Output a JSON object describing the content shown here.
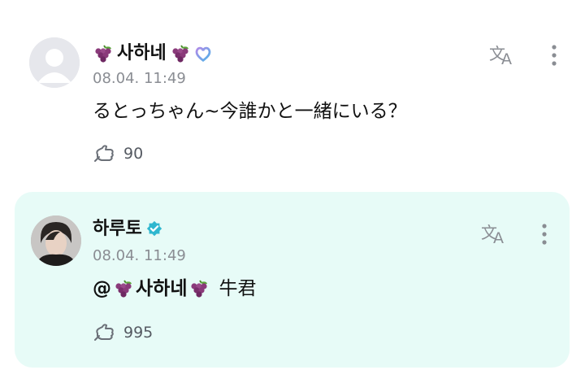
{
  "comments": [
    {
      "author": "사하네",
      "timestamp": "08.04. 11:49",
      "text": "るとっちゃん~今誰かと一緒にいる？",
      "like_count": "90",
      "badge": "heart-badge-icon"
    },
    {
      "author": "하루토",
      "timestamp": "08.04. 11:49",
      "mention": "@",
      "mention_name": "사하네",
      "text": "牛君",
      "like_count": "995",
      "badge": "verified-badge-icon"
    }
  ],
  "colors": {
    "highlight_bg": "#e7fbf7",
    "grape": "#8a3a7a",
    "verified": "#2fb7cf",
    "meta_text": "#8a8d93"
  }
}
